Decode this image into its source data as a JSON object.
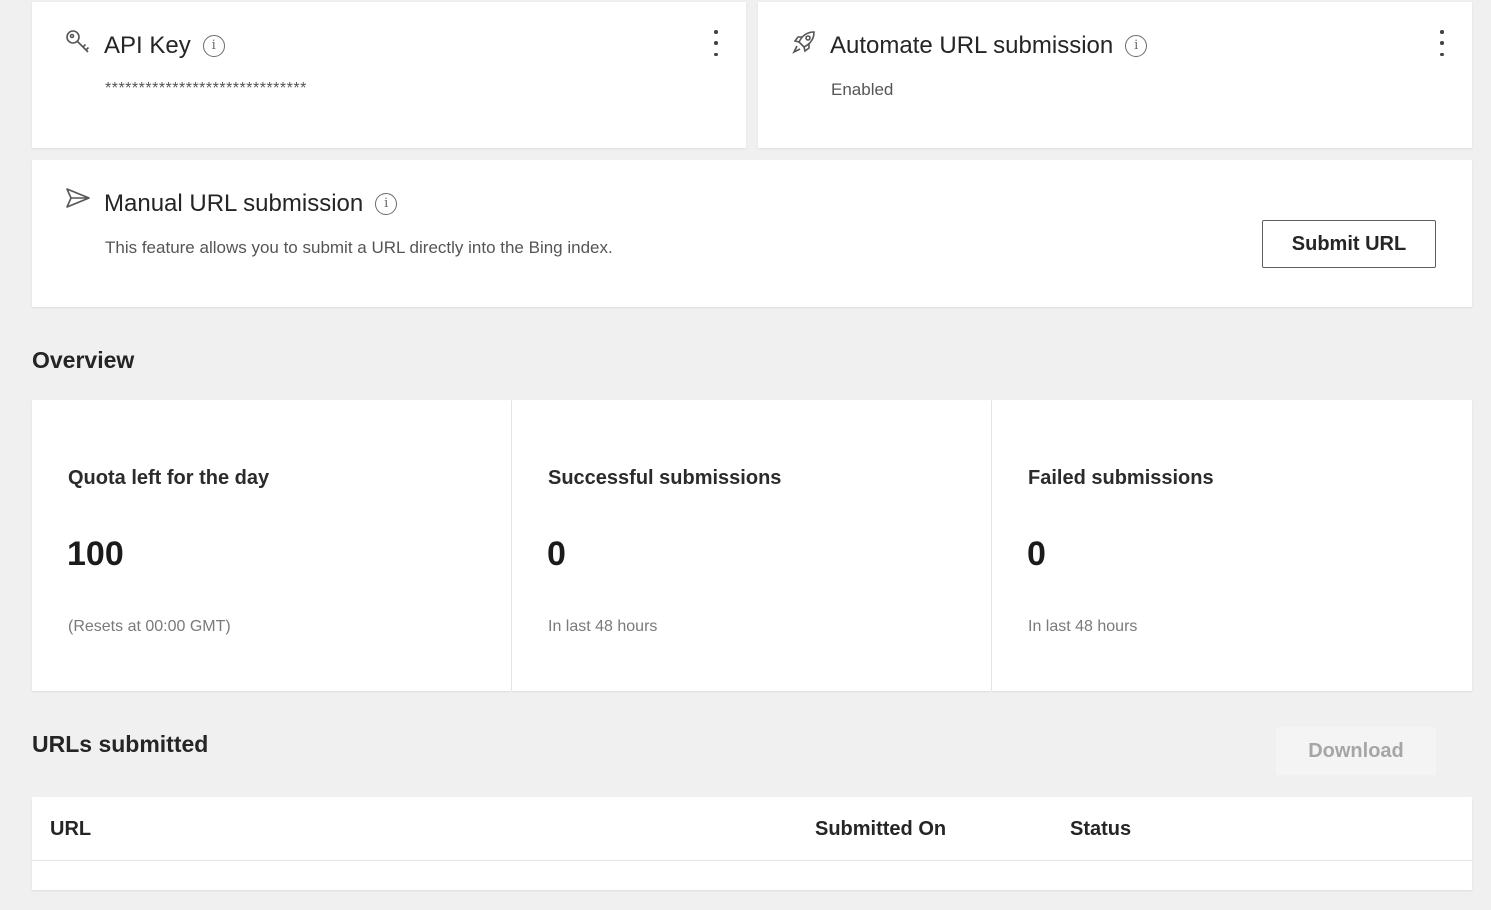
{
  "api_key": {
    "title": "API Key",
    "value": "******************************"
  },
  "automate": {
    "title": "Automate URL submission",
    "status": "Enabled"
  },
  "manual": {
    "title": "Manual URL submission",
    "description": "This feature allows you to submit a URL directly into the Bing index.",
    "button_label": "Submit URL"
  },
  "overview": {
    "title": "Overview",
    "stats": [
      {
        "label": "Quota left for the day",
        "value": "100",
        "note": "(Resets at 00:00 GMT)"
      },
      {
        "label": "Successful submissions",
        "value": "0",
        "note": "In last 48 hours"
      },
      {
        "label": "Failed submissions",
        "value": "0",
        "note": "In last 48 hours"
      }
    ]
  },
  "urls_submitted": {
    "title": "URLs submitted",
    "download_label": "Download",
    "columns": [
      "URL",
      "Submitted On",
      "Status"
    ]
  }
}
